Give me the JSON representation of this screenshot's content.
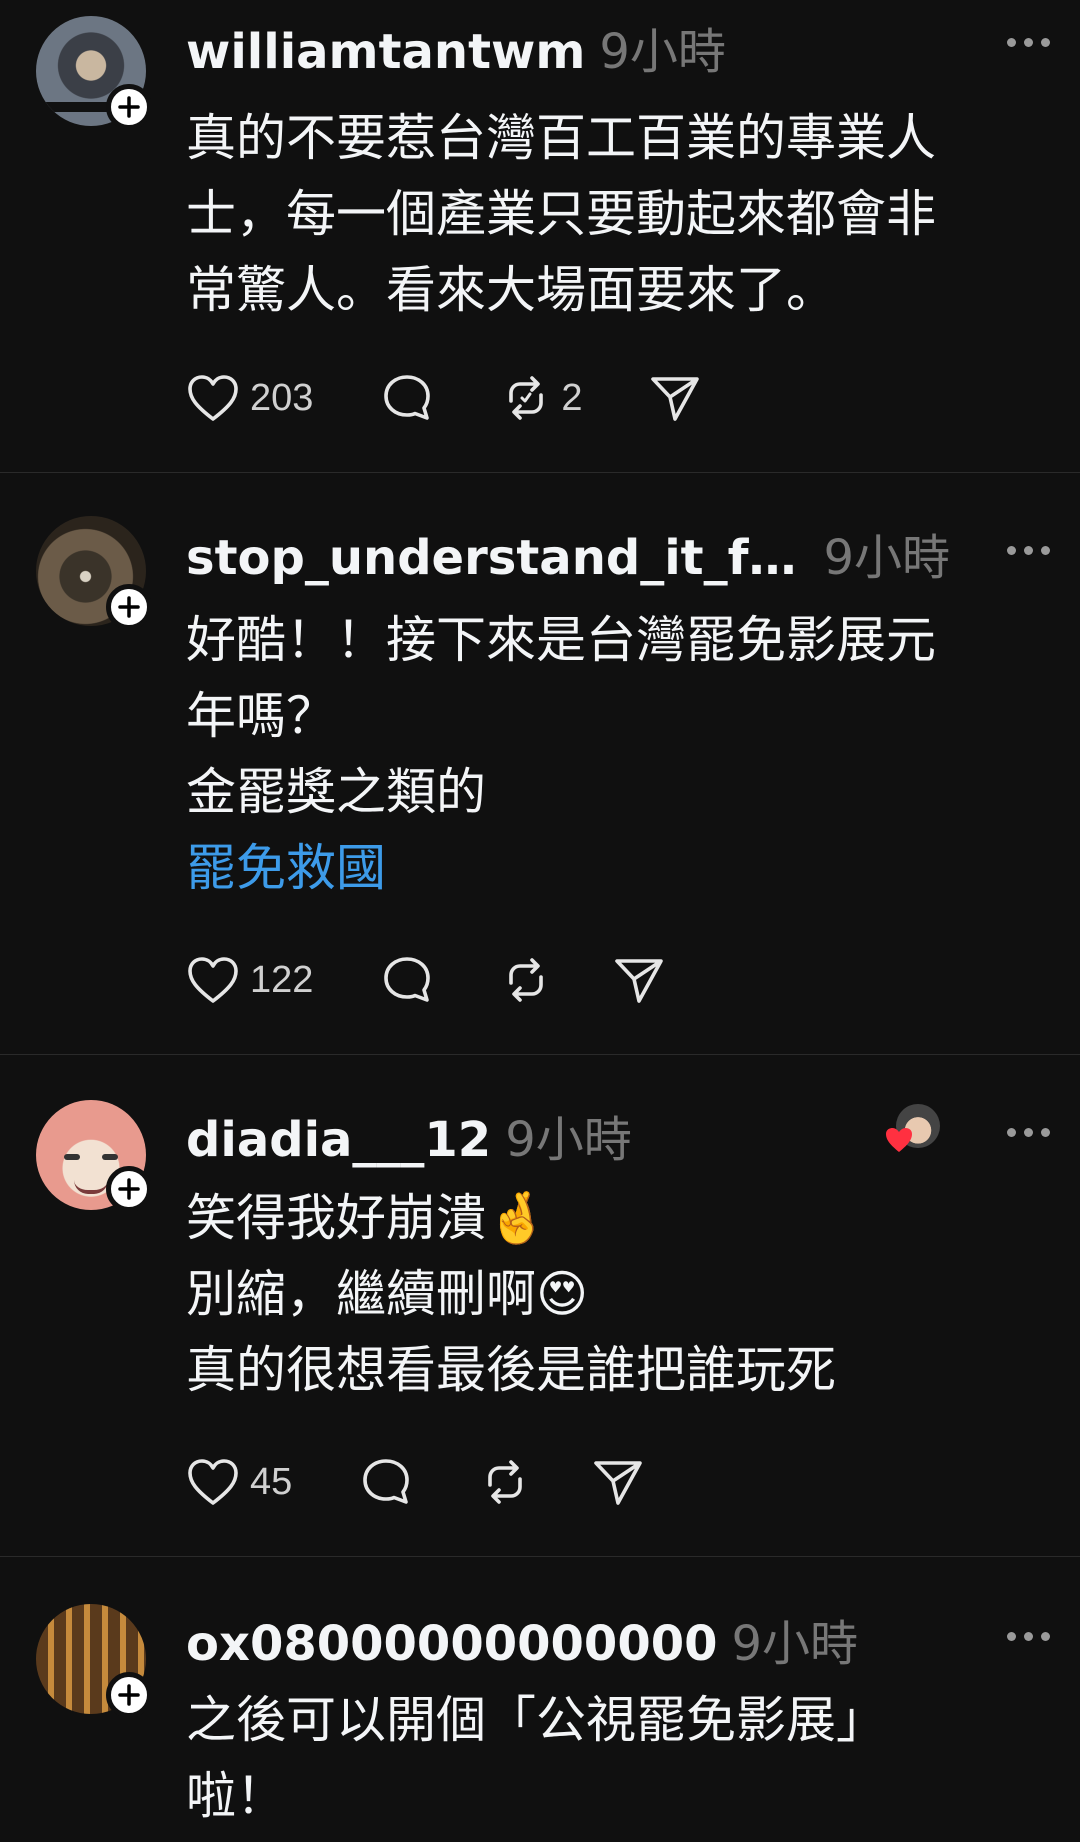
{
  "posts": [
    {
      "username": "williamtantwm",
      "time": "9小時",
      "lines": [
        "真的不要惹台灣百工百業的專業人",
        "士，每一個產業只要動起來都會非",
        "常驚人。看來大場面要來了。"
      ],
      "likes": "203",
      "reposts": "2"
    },
    {
      "username": "stop_understand_it_fee...",
      "time": "9小時",
      "lines": [
        "好酷！！接下來是台灣罷免影展元",
        "年嗎？",
        "金罷獎之類的"
      ],
      "tag": "罷免救國",
      "likes": "122"
    },
    {
      "username": "diadia___12",
      "time": "9小時",
      "lines": [
        "笑得我好崩潰🤞",
        "別縮，繼續刪啊😍",
        "真的很想看最後是誰把誰玩死"
      ],
      "likes": "45"
    },
    {
      "username": "ox08000000000000",
      "time": "9小時",
      "lines": [
        "之後可以開個「公視罷免影展」",
        "啦！"
      ]
    }
  ],
  "icons": {
    "like": "heart-icon",
    "reply": "comment-icon",
    "repost": "repost-icon",
    "share": "share-icon",
    "more": "more-icon",
    "follow": "plus-icon"
  },
  "colors": {
    "background": "#101010",
    "text": "#f3f5f7",
    "muted": "#777777",
    "hashtag": "#3d9be9",
    "divider": "#2a2a2a"
  }
}
